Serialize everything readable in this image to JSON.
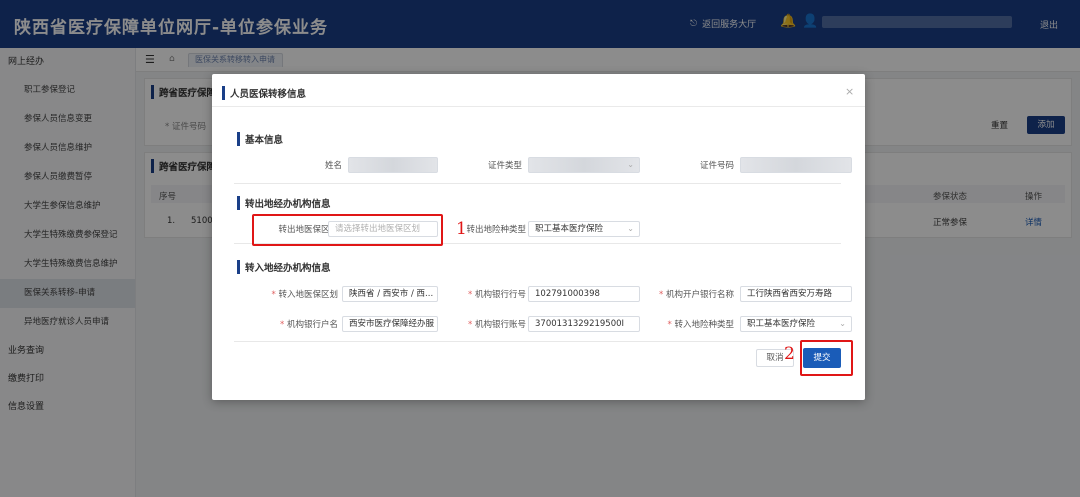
{
  "header": {
    "title": "陕西省医疗保障单位网厅-单位参保业务",
    "hall_label": "返回服务大厅",
    "logout_label": "退出"
  },
  "sidebar": {
    "groups": [
      {
        "label": "网上经办",
        "items": [
          "职工参保登记",
          "参保人员信息变更",
          "参保人员信息维护",
          "参保人员缴费暂停",
          "大学生参保信息维护",
          "大学生特殊缴费参保登记",
          "大学生特殊缴费信息维护",
          "医保关系转移-申请",
          "异地医疗就诊人员申请"
        ]
      },
      {
        "label": "业务查询",
        "items": []
      },
      {
        "label": "缴费打印",
        "items": []
      },
      {
        "label": "信息设置",
        "items": []
      }
    ],
    "active_item": "医保关系转移-申请"
  },
  "breadcrumb": {
    "tab": "医保关系转移转入申请"
  },
  "background": {
    "search_card_title": "跨省医疗保障",
    "search_label": "* 证件号码",
    "reset_label": "重置",
    "add_label": "添加",
    "list_card_title": "跨省医疗保障",
    "table": {
      "headers": [
        "序号",
        "参保状态",
        "操作"
      ],
      "row": {
        "index": "1.",
        "code": "5100",
        "status": "正常参保",
        "action": "详情"
      }
    }
  },
  "dialog": {
    "title": "人员医保转移信息",
    "basic": {
      "title": "基本信息",
      "name_label": "姓名",
      "id_type_label": "证件类型",
      "id_no_label": "证件号码"
    },
    "out": {
      "title": "转出地经办机构信息",
      "region_label": "转出地医保区划",
      "region_placeholder": "请选择转出地医保区划",
      "type_label": "转出地险种类型",
      "type_value": "职工基本医疗保险"
    },
    "in": {
      "title": "转入地经办机构信息",
      "region_label": "转入地医保区划",
      "region_value": "陕西省 / 西安市 / 西...",
      "bank_no_label": "机构银行行号",
      "bank_no_value": "102791000398",
      "bank_name_label": "机构开户银行名称",
      "bank_name_value": "工行陕西省西安万寿路",
      "account_name_label": "机构银行户名",
      "account_name_value": "西安市医疗保障经办服",
      "account_no_label": "机构银行账号",
      "account_no_value": "3700131329219500I",
      "type_label": "转入地险种类型",
      "type_value": "职工基本医疗保险"
    },
    "cancel_label": "取消",
    "submit_label": "提交",
    "close_symbol": "×"
  },
  "annotations": {
    "one": "1",
    "two": "2"
  },
  "colors": {
    "header_bg": "#1a3f88",
    "accent": "#1a5cb8",
    "annotation": "#e01616"
  }
}
